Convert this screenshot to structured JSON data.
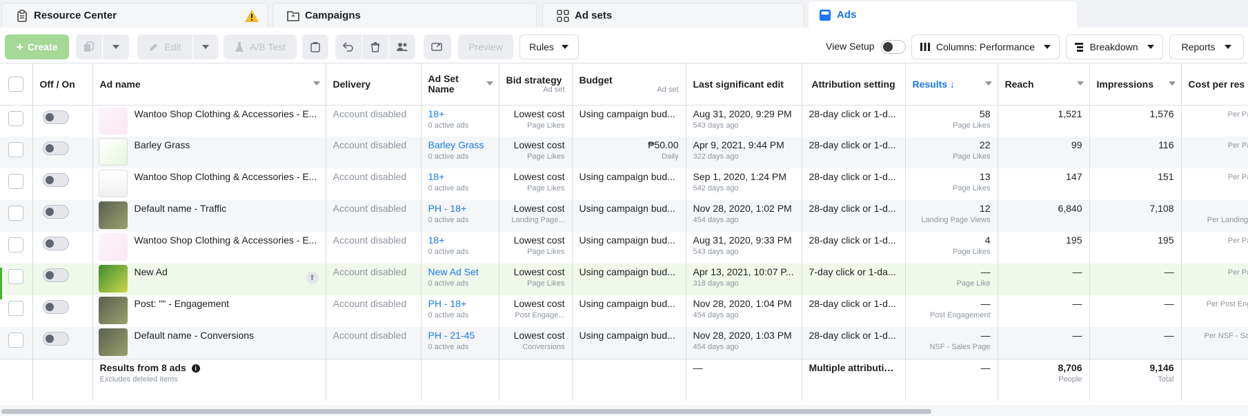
{
  "tabs": [
    {
      "label": "Resource Center",
      "icon": "clipboard-icon"
    },
    {
      "label": "Campaigns",
      "icon": "folder-icon"
    },
    {
      "label": "Ad sets",
      "icon": "grid-icon"
    },
    {
      "label": "Ads",
      "icon": "ad-icon"
    }
  ],
  "toolbar": {
    "create": "Create",
    "edit": "Edit",
    "ab_test": "A/B Test",
    "preview": "Preview",
    "rules": "Rules",
    "view_setup": "View Setup",
    "columns": "Columns: Performance",
    "breakdown": "Breakdown",
    "reports": "Reports"
  },
  "headers": {
    "off_on": "Off / On",
    "ad_name": "Ad name",
    "delivery": "Delivery",
    "ad_set_name": "Ad Set Name",
    "bid_strategy": "Bid strategy",
    "bid_strategy_sub": "Ad set",
    "budget": "Budget",
    "budget_sub": "Ad set",
    "last_edit": "Last significant edit",
    "attribution": "Attribution setting",
    "results": "Results ↓",
    "reach": "Reach",
    "impressions": "Impressions",
    "cost_per": "Cost per res"
  },
  "rows": [
    {
      "name": "Wantoo Shop Clothing & Accessories - E...",
      "delivery": "Account disabled",
      "adset": "18+",
      "adset_sub": "0 active ads",
      "bid": "Lowest cost",
      "bid_sub": "Page Likes",
      "budget": "Using campaign bud...",
      "budget_sub": "",
      "edit": "Aug 31, 2020, 9:29 PM",
      "edit_sub": "543 days ago",
      "attr": "28-day click or 1-d...",
      "results": "58",
      "results_sub": "Page Likes",
      "reach": "1,521",
      "impr": "1,576",
      "cost": "",
      "cost_sub": "Per Pag"
    },
    {
      "name": "Barley Grass",
      "delivery": "Account disabled",
      "adset": "Barley Grass",
      "adset_sub": "0 active ads",
      "bid": "Lowest cost",
      "bid_sub": "Page Likes",
      "budget": "₱50.00",
      "budget_sub": "Daily",
      "edit": "Apr 9, 2021, 9:44 PM",
      "edit_sub": "322 days ago",
      "attr": "28-day click or 1-d...",
      "results": "22",
      "results_sub": "Page Likes",
      "reach": "99",
      "impr": "116",
      "cost": "",
      "cost_sub": "Per Pag"
    },
    {
      "name": "Wantoo Shop Clothing & Accessories - E...",
      "delivery": "Account disabled",
      "adset": "18+",
      "adset_sub": "0 active ads",
      "bid": "Lowest cost",
      "bid_sub": "Page Likes",
      "budget": "Using campaign bud...",
      "budget_sub": "",
      "edit": "Sep 1, 2020, 1:24 PM",
      "edit_sub": "542 days ago",
      "attr": "28-day click or 1-d...",
      "results": "13",
      "results_sub": "Page Likes",
      "reach": "147",
      "impr": "151",
      "cost": "",
      "cost_sub": "Per Pag"
    },
    {
      "name": "Default name - Traffic",
      "delivery": "Account disabled",
      "adset": "PH - 18+",
      "adset_sub": "0 active ads",
      "bid": "Lowest cost",
      "bid_sub": "Landing Page...",
      "budget": "Using campaign bud...",
      "budget_sub": "",
      "edit": "Nov 28, 2020, 1:02 PM",
      "edit_sub": "454 days ago",
      "attr": "28-day click or 1-d...",
      "results": "12",
      "results_sub": "Landing Page Views",
      "reach": "6,840",
      "impr": "7,108",
      "cost": "₱",
      "cost_sub": "Per Landing P"
    },
    {
      "name": "Wantoo Shop Clothing & Accessories - E...",
      "delivery": "Account disabled",
      "adset": "18+",
      "adset_sub": "0 active ads",
      "bid": "Lowest cost",
      "bid_sub": "Page Likes",
      "budget": "Using campaign bud...",
      "budget_sub": "",
      "edit": "Aug 31, 2020, 9:33 PM",
      "edit_sub": "543 days ago",
      "attr": "28-day click or 1-d...",
      "results": "4",
      "results_sub": "Page Likes",
      "reach": "195",
      "impr": "195",
      "cost": "",
      "cost_sub": "Per Pag"
    },
    {
      "name": "New Ad",
      "delivery": "Account disabled",
      "adset": "New Ad Set",
      "adset_sub": "0 active ads",
      "bid": "Lowest cost",
      "bid_sub": "Page Likes",
      "budget": "Using campaign bud...",
      "budget_sub": "",
      "edit": "Apr 13, 2021, 10:07 P...",
      "edit_sub": "318 days ago",
      "attr": "7-day click or 1-da...",
      "results": "—",
      "results_sub": "Page Like",
      "reach": "—",
      "impr": "—",
      "cost": "",
      "cost_sub": "Per Pag"
    },
    {
      "name": "Post: \"\" - Engagement",
      "delivery": "Account disabled",
      "adset": "PH - 18+",
      "adset_sub": "0 active ads",
      "bid": "Lowest cost",
      "bid_sub": "Post Engage...",
      "budget": "Using campaign bud...",
      "budget_sub": "",
      "edit": "Nov 28, 2020, 1:04 PM",
      "edit_sub": "454 days ago",
      "attr": "28-day click or 1-d...",
      "results": "—",
      "results_sub": "Post Engagement",
      "reach": "—",
      "impr": "—",
      "cost": "",
      "cost_sub": "Per Post Enga"
    },
    {
      "name": "Default name - Conversions",
      "delivery": "Account disabled",
      "adset": "PH - 21-45",
      "adset_sub": "0 active ads",
      "bid": "Lowest cost",
      "bid_sub": "Conversions",
      "budget": "Using campaign bud...",
      "budget_sub": "",
      "edit": "Nov 28, 2020, 1:03 PM",
      "edit_sub": "454 days ago",
      "attr": "28-day click or 1-d...",
      "results": "—",
      "results_sub": "NSF - Sales Page",
      "reach": "—",
      "impr": "—",
      "cost": "",
      "cost_sub": "Per NSF - Sale"
    }
  ],
  "footer": {
    "label": "Results from 8 ads",
    "sub": "Excludes deleted items",
    "edit": "—",
    "attr": "Multiple attribution...",
    "results": "—",
    "reach": "8,706",
    "reach_sub": "People",
    "impr": "9,146",
    "impr_sub": "Total"
  },
  "colors": {
    "accent": "#1877f2",
    "create": "#a4d996",
    "warning": "#f7b928"
  }
}
